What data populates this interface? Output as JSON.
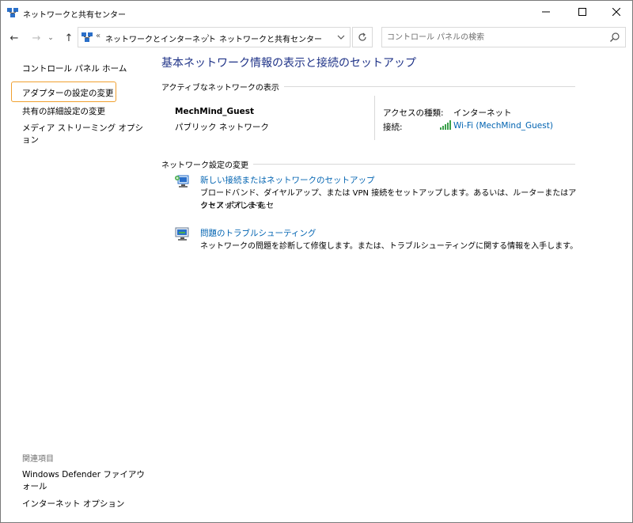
{
  "window": {
    "title": "ネットワークと共有センター"
  },
  "address": {
    "chevron": "«",
    "crumb1": "ネットワークとインターネット",
    "separator": "›",
    "crumb2": "ネットワークと共有センター"
  },
  "search": {
    "placeholder": "コントロール パネルの検索"
  },
  "sidebar": {
    "home": "コントロール パネル ホーム",
    "items": [
      {
        "label": "アダプターの設定の変更"
      },
      {
        "label": "共有の詳細設定の変更"
      },
      {
        "label": "メディア ストリーミング オプション"
      }
    ],
    "related_header": "関連項目",
    "related": [
      {
        "label": "Windows Defender ファイアウォール"
      },
      {
        "label": "インターネット オプション"
      }
    ]
  },
  "main": {
    "title": "基本ネットワーク情報の表示と接続のセットアップ",
    "active_header": "アクティブなネットワークの表示",
    "network": {
      "name": "MechMind_Guest",
      "category": "パブリック ネットワーク",
      "access_label": "アクセスの種類:",
      "access_value": "インターネット",
      "connection_label": "接続:",
      "connection_value": "Wi-Fi (MechMind_Guest)"
    },
    "change_header": "ネットワーク設定の変更",
    "tasks": [
      {
        "link": "新しい接続またはネットワークのセットアップ",
        "desc_line1": "ブロードバンド、ダイヤルアップ、または VPN 接続をセットアップします。あるいは、ルーターまたはアクセス ポイントをセ",
        "desc_line2": "ットアップします。"
      },
      {
        "link": "問題のトラブルシューティング",
        "desc_line1": "ネットワークの問題を診断して修復します。または、トラブルシューティングに関する情報を入手します。",
        "desc_line2": ""
      }
    ]
  },
  "colors": {
    "link": "#0063b1",
    "title": "#1e3287",
    "focus": "#f0a030"
  }
}
